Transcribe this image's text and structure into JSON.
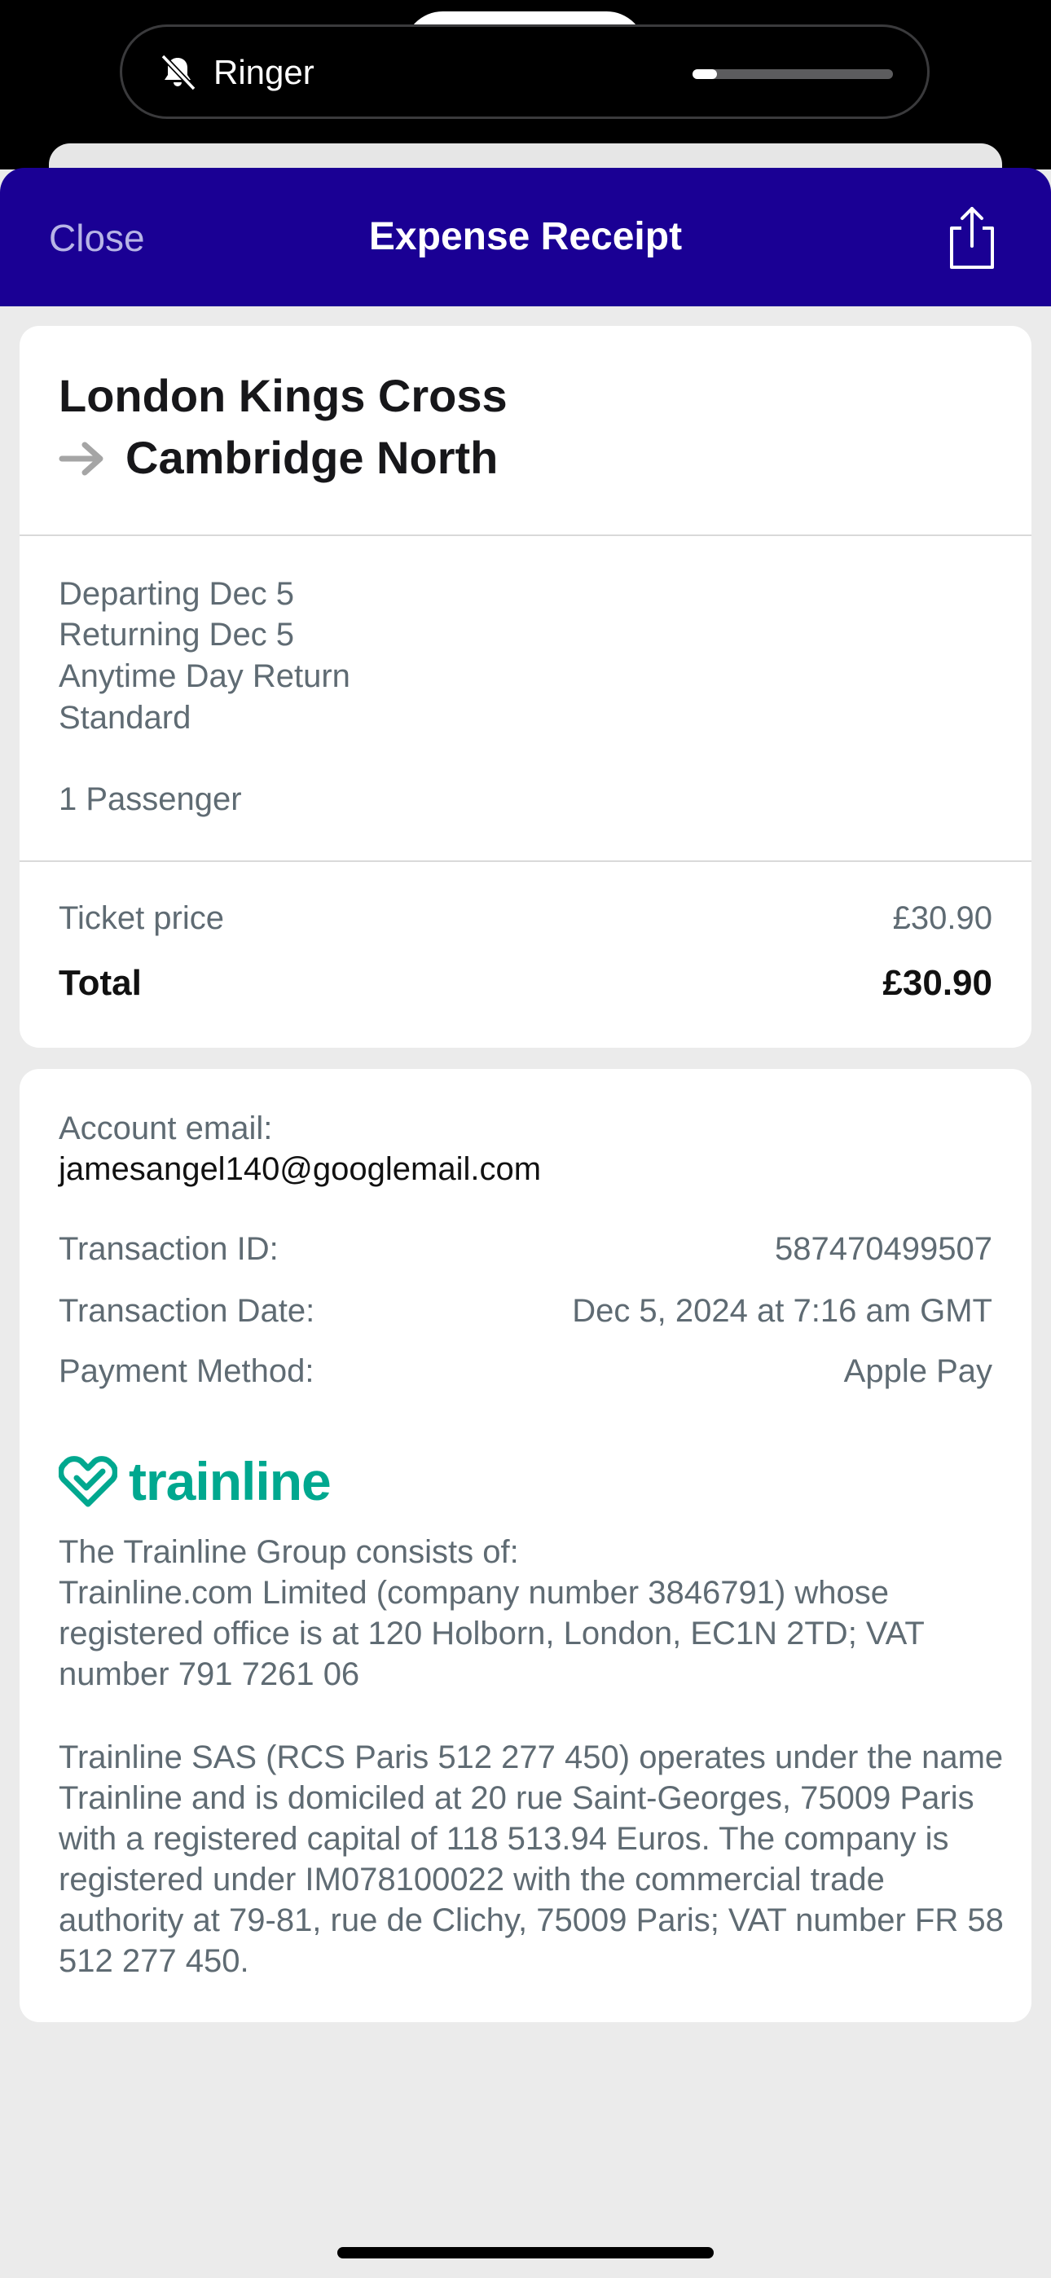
{
  "status": {
    "ringer_label": "Ringer",
    "ringer_volume": 0.12
  },
  "nav": {
    "close_label": "Close",
    "title": "Expense Receipt",
    "share_icon": "share-icon"
  },
  "journey": {
    "from": "London Kings Cross",
    "to": "Cambridge North",
    "departing": "Departing Dec 5",
    "returning": "Returning Dec 5",
    "ticket_type": "Anytime Day Return",
    "class": "Standard",
    "passengers": "1 Passenger"
  },
  "pricing": {
    "ticket_price_label": "Ticket price",
    "ticket_price_value": "£30.90",
    "total_label": "Total",
    "total_value": "£30.90"
  },
  "account": {
    "email_label": "Account email:",
    "email_value": "jamesangel140@googlemail.com",
    "transaction_id_label": "Transaction ID:",
    "transaction_id_value": "587470499507",
    "transaction_date_label": "Transaction Date:",
    "transaction_date_value": "Dec 5, 2024 at 7:16 am GMT",
    "payment_method_label": "Payment Method:",
    "payment_method_value": "Apple Pay"
  },
  "brand": {
    "logo_text": "trainline",
    "color": "#00a88f"
  },
  "legal": {
    "paragraph_1": "The Trainline Group consists of:\nTrainline.com Limited (company number 3846791) whose registered office is at 120 Holborn, London, EC1N 2TD; VAT number 791 7261 06",
    "paragraph_2": "Trainline SAS (RCS Paris 512 277 450) operates under the name Trainline and is domiciled at 20 rue Saint-Georges, 75009 Paris with a registered capital of 118 513.94 Euros. The company is registered under IM078100022 with the commercial trade authority at 79-81, rue de Clichy, 75009 Paris; VAT number FR 58 512 277 450."
  },
  "colors": {
    "navbar": "#1a0094",
    "background": "#ebebeb",
    "secondary_text": "#5f6b73"
  }
}
